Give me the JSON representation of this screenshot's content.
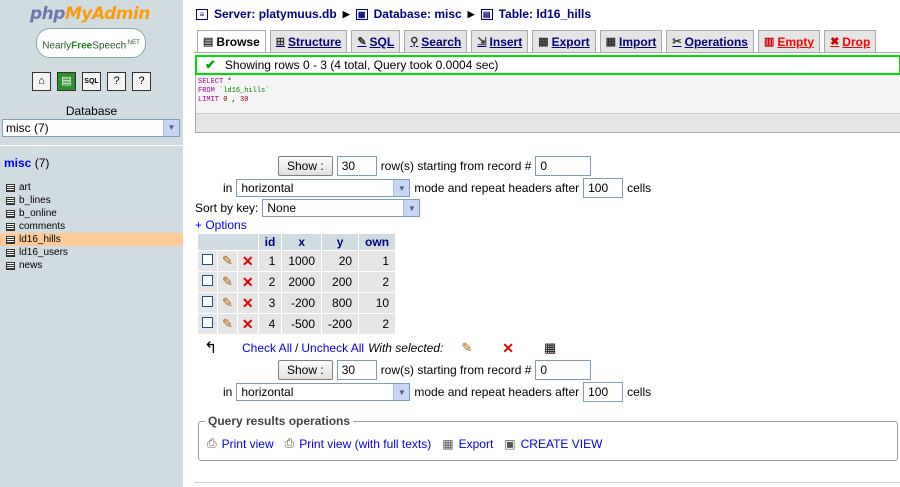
{
  "logo": {
    "part1": "php",
    "part2": "MyAdmin",
    "badge_prefix": "Nearly",
    "badge_strong": "Free",
    "badge_suffix": "Speech",
    "badge_sup": ".NET"
  },
  "nav": {
    "database_label": "Database",
    "database_selected": "misc (7)",
    "db_heading_name": "misc",
    "db_heading_count": "(7)",
    "tables": [
      "art",
      "b_lines",
      "b_online",
      "comments",
      "ld16_hills",
      "ld16_users",
      "news"
    ],
    "active_table": "ld16_hills"
  },
  "breadcrumb": {
    "server": "Server: platymuus.db",
    "database": "Database: misc",
    "table": "Table: ld16_hills"
  },
  "tabs": [
    {
      "label": "Browse",
      "icon": "browse-icon"
    },
    {
      "label": "Structure",
      "icon": "structure-icon"
    },
    {
      "label": "SQL",
      "icon": "sql-icon"
    },
    {
      "label": "Search",
      "icon": "search-icon"
    },
    {
      "label": "Insert",
      "icon": "insert-icon"
    },
    {
      "label": "Export",
      "icon": "export-icon"
    },
    {
      "label": "Import",
      "icon": "import-icon"
    },
    {
      "label": "Operations",
      "icon": "operations-icon"
    },
    {
      "label": "Empty",
      "icon": "empty-icon"
    },
    {
      "label": "Drop",
      "icon": "drop-icon"
    }
  ],
  "status": {
    "message": "Showing rows 0 - 3 (4 total, Query took 0.0004 sec)"
  },
  "sql": {
    "select": "SELECT",
    "star": "*",
    "from": "FROM",
    "table": "`ld16_hills`",
    "limit": "LIMIT",
    "offset": "0",
    "comma": ",",
    "count": "30"
  },
  "nav_form": {
    "show_label": "Show :",
    "rows_value": "30",
    "rows_text": "row(s) starting from record #",
    "start_value": "0",
    "in_text": "in",
    "mode_value": "horizontal",
    "mode_text": "mode and repeat headers after",
    "repeat_value": "100",
    "cells_text": "cells"
  },
  "sort": {
    "label": "Sort by key:",
    "value": "None"
  },
  "options_link": "+ Options",
  "table": {
    "columns": [
      "id",
      "x",
      "y",
      "own"
    ],
    "rows": [
      [
        "1",
        "1000",
        "20",
        "1"
      ],
      [
        "2",
        "2000",
        "200",
        "2"
      ],
      [
        "3",
        "-200",
        "800",
        "10"
      ],
      [
        "4",
        "-500",
        "-200",
        "2"
      ]
    ]
  },
  "with_selected": {
    "check_all": "Check All",
    "sep": "/",
    "uncheck_all": "Uncheck All",
    "label": "With selected:"
  },
  "query_ops": {
    "legend": "Query results operations",
    "print_view": "Print view",
    "print_view_full": "Print view (with full texts)",
    "export": "Export",
    "create_view": "CREATE VIEW"
  },
  "colors": {
    "nav_bg": "#d0dce0",
    "success_border": "#00dd00",
    "active_row": "#ffcc99",
    "link": "#0000ee",
    "header_text": "#000080"
  }
}
